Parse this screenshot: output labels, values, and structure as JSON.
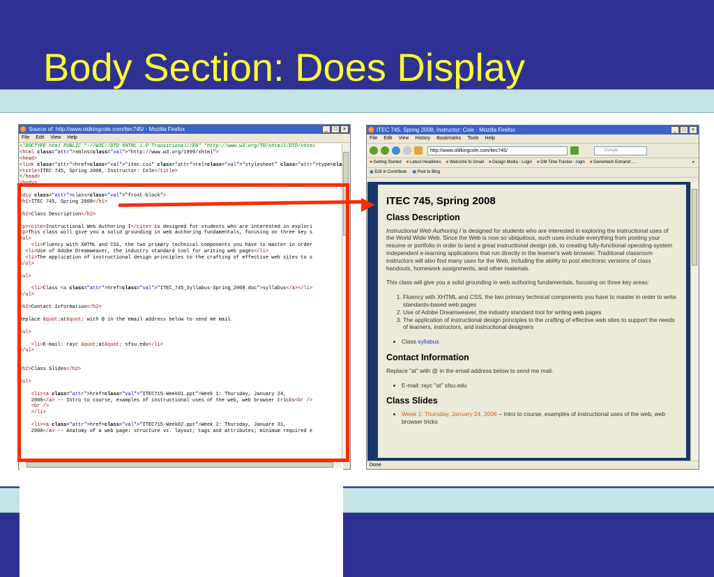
{
  "slide": {
    "title": "Body Section: Does Display"
  },
  "source_window": {
    "title": "Source of: http://www.oldkingcole.com/itec745/ - Mozilla Firefox",
    "menu": [
      "File",
      "Edit",
      "View",
      "Help"
    ],
    "lines": [
      "<!DOCTYPE html PUBLIC \"-//W3C//DTD XHTML 1.0 Transitional//EN\" \"http://www.w3.org/TR/xhtml1/DTD/xhtml",
      "<html xmlns=\"http://www.w3.org/1999/xhtml\">",
      "<head>",
      "<link href=\"itec.css\" rel=\"stylesheet\" type=\"text/css\" />",
      "<title>ITEC 745, Spring 2008, Instructor: Cole</title>",
      "</head>",
      "<body>",
      "",
      "<div class=\"frost-block\">",
      "<h1>ITEC 745, Spring 2008</h1>",
      "",
      "<h2>Class Description</h2>",
      "",
      "<p><cite>Instructional Web Authoring I</cite> is designed for students who are interested in explori",
      "<p>This class will give you a solid grounding in web authoring fundamentals, focusing on three key s",
      "<ol>",
      "    <li>Fluency with XHTML and CSS, the two primary technical components you have to master in order",
      "  <li>Use of Adobe Dreamweaver, the industry standard tool for writing web pages</li>",
      "  <li>The application of instructional design principles to the crafting of effective web sites to s",
      "</ol>",
      "",
      "<ul>",
      "",
      "    <li>Class <a href=\"ITEC_745_Syllabus-Spring_2008.doc\">syllabus</a></li>",
      "</ul>",
      "",
      "<h2>Contact Information</h2>",
      "",
      "Replace &quot;at&quot; with @ in the email address below to send me mail.",
      "",
      "<ul>",
      "",
      "    <li>E-mail: rayc &quot;at&quot; sfsu.edu</li>",
      "</ul>",
      "",
      "",
      "<h2>Class Slides</h2>",
      "",
      "<ul>",
      "",
      "    <li><a href=\"ITEC715-Week01.ppt\">Week 1: Thursday, January 24,",
      "    2008</a> -- Intro to course, examples of instructional uses of the web, web browser tricks<br />",
      "    <br />",
      "    </li>",
      "",
      "    <li><a href=\"ITEC715-Week02.ppt\">Week 2: Thursday, Januare 31,",
      "    2008</a> -- Anatomy of a web page: structure vs. layout; tags and attributes; minimum required e"
    ]
  },
  "browser_window": {
    "title": "ITEC 745, Spring 2008, Instructor: Cole - Mozilla Firefox",
    "menu": [
      "File",
      "Edit",
      "View",
      "History",
      "Bookmarks",
      "Tools",
      "Help"
    ],
    "url": "http://www.oldkingcole.com/itec745/",
    "search_placeholder": "Google",
    "bookmarks": [
      "Getting Started",
      "Latest Headlines",
      "Welcome to Gmail",
      "Design Media - Login",
      "DM Time Tracker - login",
      "Genentech Extranet ..."
    ],
    "bookmarks_more": "»",
    "contribute": [
      "Edit in Contribute",
      "Post to Blog"
    ],
    "status": "Done",
    "page": {
      "h1": "ITEC 745, Spring 2008",
      "h2_description": "Class Description",
      "desc_cite": "Instructional Web Authoring I",
      "desc_rest": " is designed for students who are interested in exploring the instructional uses of the World Wide Web. Since the Web is now so ubiquitous, such uses include everything from posting your resume or portfolio in order to land a great instructional design job, to creating fully-functional operating-system independent e-learning applications that run directly in the learner's web browser. Traditional classroom instructors will also find many uses for the Web, including the ability to post electronic versions of class handouts, homework assignments, and other materials.",
      "para2": "This class will give you a solid grounding in web authoring fundamentals, focusing on three key areas:",
      "areas": [
        "Fluency with XHTML and CSS, the two primary technical components you have to master in order to write standards-based web pages",
        "Use of Adobe Dreamweaver, the industry standard tool for writing web pages",
        "The application of instructional design principles to the crafting of effective web sites to support the needs of learners, instructors, and instructional designers"
      ],
      "class_label": "Class ",
      "syllabus_link": "syllabus",
      "h2_contact": "Contact Information",
      "contact_text": "Replace \"at\" with @ in the email address below to send me mail.",
      "email": "E-mail: rayc \"at\" sfsu.edu",
      "h2_slides": "Class Slides",
      "week1_link": "Week 1: Thursday, January 24, 2008",
      "week1_rest": " -- Intro to course, examples of instructional uses of the web, web browser tricks"
    }
  },
  "colors": {
    "slide_bg": "#2e3192",
    "title": "#ffff33",
    "band": "#c6e4e6",
    "highlight": "#ff2a00"
  }
}
